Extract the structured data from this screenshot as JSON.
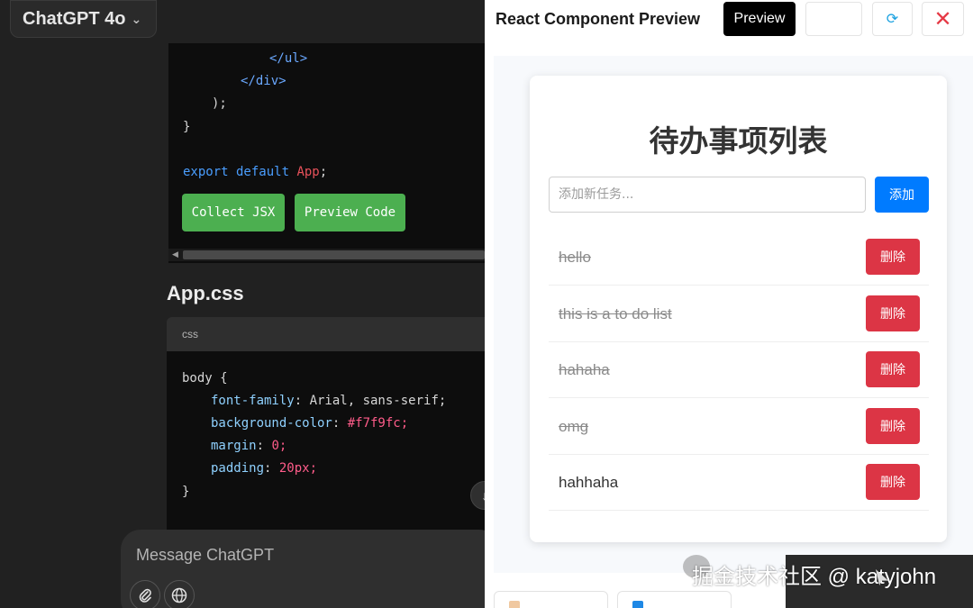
{
  "chat": {
    "model_selector": "ChatGPT 4o",
    "code_top_lines": [
      "</ul>",
      "</div>",
      ");",
      "}",
      "export default App;"
    ],
    "export_keyword": "export default",
    "export_name": "App",
    "buttons": {
      "collect": "Collect JSX",
      "preview": "Preview Code"
    },
    "file_title": "App.css",
    "code_lang": "css",
    "css": {
      "selector": "body {",
      "props": [
        {
          "name": "font-family",
          "value": "Arial, sans-serif;"
        },
        {
          "name": "background-color",
          "value": "#f7f9fc;"
        },
        {
          "name": "margin",
          "value": "0;"
        },
        {
          "name": "padding",
          "value": "20px;"
        }
      ],
      "close": "}"
    },
    "composer_placeholder": "Message ChatGPT"
  },
  "preview": {
    "title": "React Component Preview",
    "preview_button": "Preview",
    "close_symbol": "✕",
    "refresh_symbol": "⟳",
    "todo": {
      "heading": "待办事项列表",
      "input_placeholder": "添加新任务...",
      "add_label": "添加",
      "delete_label": "删除",
      "items": [
        {
          "text": "hello",
          "done": true
        },
        {
          "text": "this is a to do list",
          "done": true
        },
        {
          "text": "hahaha",
          "done": true
        },
        {
          "text": "omg",
          "done": true
        },
        {
          "text": "hahhaha",
          "done": false
        }
      ]
    }
  },
  "watermark": "掘金技术社区 @ katyjohn"
}
